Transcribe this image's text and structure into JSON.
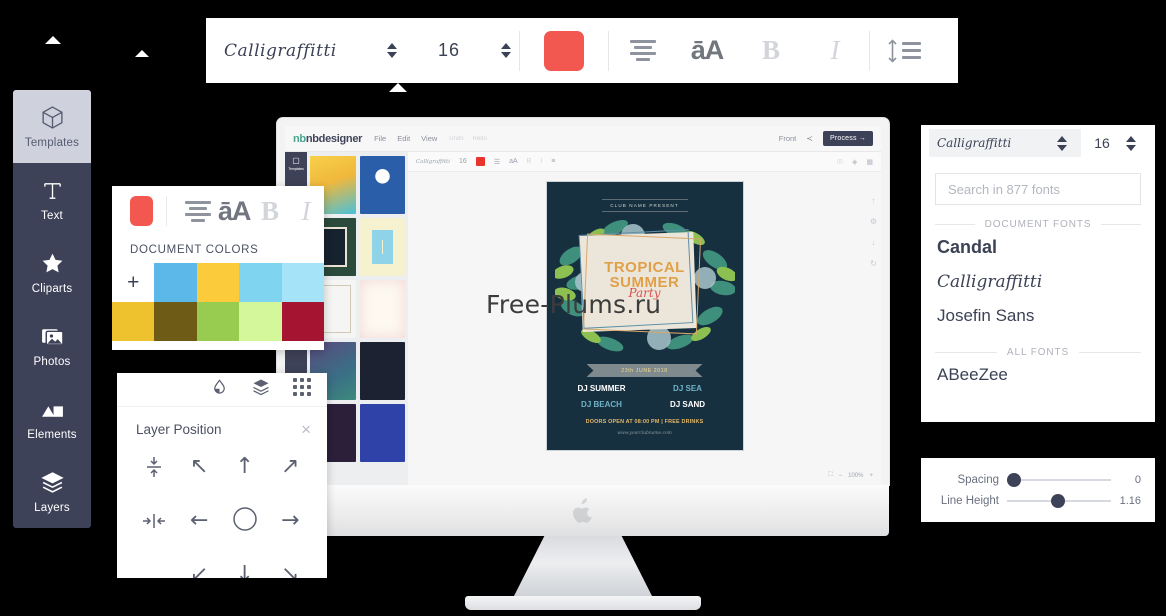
{
  "watermark": "Free-Plums.ru",
  "top_toolbar": {
    "font_name": "Calligraffitti",
    "font_size": "16",
    "color_swatch": "#f2584f",
    "buttons": [
      {
        "name": "align",
        "label": "align-icon"
      },
      {
        "name": "case",
        "label": "āA"
      },
      {
        "name": "bold",
        "label": "B"
      },
      {
        "name": "italic",
        "label": "I"
      },
      {
        "name": "line-height",
        "label": "line-height-icon"
      }
    ]
  },
  "left_rail": {
    "items": [
      {
        "label": "Templates",
        "icon": "box-icon",
        "active": true
      },
      {
        "label": "Text",
        "icon": "text-t-icon",
        "active": false
      },
      {
        "label": "Cliparts",
        "icon": "star-icon",
        "active": false
      },
      {
        "label": "Photos",
        "icon": "photo-icon",
        "active": false
      },
      {
        "label": "Elements",
        "icon": "shapes-icon",
        "active": false
      },
      {
        "label": "Layers",
        "icon": "layers-icon",
        "active": false
      }
    ],
    "active_bg": "#cfd2dd",
    "bg": "#3e4258"
  },
  "document_colors": {
    "swatch": "#f2584f",
    "title": "DOCUMENT COLORS",
    "add_label": "+",
    "colors": [
      "#ffffff",
      "#5bb8e8",
      "#fbcb3c",
      "#7fd4f0",
      "#a5e4f8",
      "#eec12e",
      "#6e5c16",
      "#97cc50",
      "#d3f79a",
      "#a51531"
    ],
    "toolbar_glyphs": [
      "align-icon",
      "āA",
      "B",
      "I"
    ]
  },
  "layer_position": {
    "title": "Layer Position",
    "close": "×",
    "toolbar_icons": [
      "fill-drop-icon",
      "layers-icon",
      "grid-icon"
    ],
    "buttons": [
      "align-vertical-center-icon",
      "↖",
      "↑",
      "↗",
      "align-horizontal-center-icon",
      "←",
      "center-circle-icon",
      "→",
      "",
      "↙",
      "↓",
      "↘"
    ]
  },
  "font_panel": {
    "selected_font": "Calligraffitti",
    "font_size": "16",
    "search_placeholder": "Search in 877 fonts",
    "document_fonts_label": "DOCUMENT FONTS",
    "all_fonts_label": "ALL FONTS",
    "document_fonts": [
      "Candal",
      "Calligraffitti",
      "Josefin Sans"
    ],
    "all_fonts": [
      "ABeeZee"
    ]
  },
  "spacing_panel": {
    "rows": [
      {
        "label": "Spacing",
        "value": "0",
        "position": 8
      },
      {
        "label": "Line Height",
        "value": "1.16",
        "position": 48
      }
    ]
  },
  "app": {
    "logo": "nbdesigner",
    "logo_mark": "nb",
    "menu": [
      "File",
      "Edit",
      "View"
    ],
    "undo_label": "Undo",
    "redo_label": "Redo",
    "side_label": "Front",
    "share_icon": "share-icon",
    "process_button": "Process →",
    "rail_label": "Templates",
    "subbar_font": "Calligraffitti",
    "subbar_size": "16",
    "subbar_swatch": "#e8362c",
    "zoom_level": "100%",
    "zoom_minus": "−",
    "zoom_plus": "+"
  },
  "poster": {
    "club_line": "CLUB NAME PRESENT",
    "title_line1": "TROPICAL",
    "title_line2": "SUMMER",
    "title_script": "Party",
    "date_ribbon": "23th JUNE 2018",
    "djs": [
      "DJ SUMMER",
      "DJ SEA",
      "DJ BEACH",
      "DJ SAND"
    ],
    "doors": "DOORS OPEN AT 08:00 PM | FREE DRINKS",
    "url": "www.yourclubname.com",
    "bg": "#17303f"
  },
  "templates": [
    {
      "name": "summer-beach-party",
      "bg": "#f5c842",
      "accent": "#2fa8c8"
    },
    {
      "name": "current-star-blue",
      "bg": "#1f3a6e",
      "accent": "#4db8e8"
    },
    {
      "name": "tropical-summer-dark",
      "bg": "#16222e",
      "accent": "#8bc34a"
    },
    {
      "name": "sale-cream",
      "bg": "#f6f1d4",
      "accent": "#f08a3c"
    },
    {
      "name": "new-year-white",
      "bg": "#f4f4f2",
      "accent": "#d94f4f"
    },
    {
      "name": "music-festival",
      "bg": "#fbf7ef",
      "accent": "#e53d6a"
    },
    {
      "name": "electro-night",
      "bg": "#4a3a6b",
      "accent": "#4fd9c8"
    },
    {
      "name": "2018-party",
      "bg": "#1d2233",
      "accent": "#e8318a"
    },
    {
      "name": "bonfire-festa",
      "bg": "#2b1f3a",
      "accent": "#f5a623"
    },
    {
      "name": "ram-navami",
      "bg": "#2d3fa0",
      "accent": "#f5c842"
    }
  ]
}
